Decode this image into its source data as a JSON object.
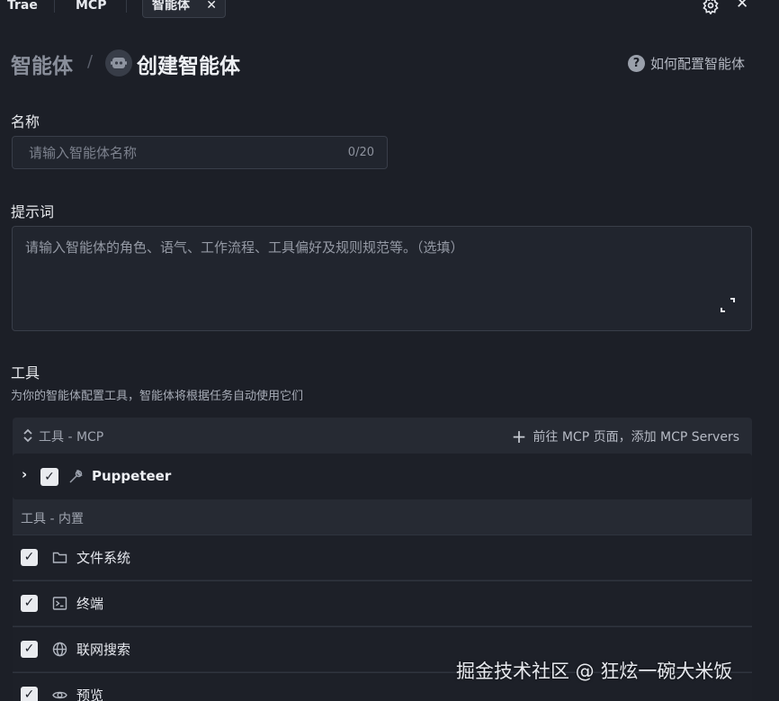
{
  "tabs": [
    {
      "label": "Trae"
    },
    {
      "label": "MCP"
    },
    {
      "label": "智能体",
      "active": true
    }
  ],
  "header": {
    "breadcrumb_root": "智能体",
    "breadcrumb_sep": "/",
    "title": "创建智能体",
    "help_link": "如何配置智能体"
  },
  "form": {
    "name": {
      "label": "名称",
      "placeholder": "请输入智能体名称",
      "value": "",
      "counter": "0/20"
    },
    "prompt": {
      "label": "提示词",
      "placeholder": "请输入智能体的角色、语气、工作流程、工具偏好及规则规范等。（选填）",
      "value": ""
    }
  },
  "tools": {
    "label": "工具",
    "description": "为你的智能体配置工具，智能体将根据任务自动使用它们",
    "mcp_section": "工具 - MCP",
    "add_mcp": "前往 MCP 页面，添加 MCP Servers",
    "mcp_items": [
      {
        "name": "Puppeteer",
        "checked": true,
        "icon": "wrench-icon"
      }
    ],
    "builtin_section": "工具 - 内置",
    "builtin_items": [
      {
        "name": "文件系统",
        "checked": true,
        "icon": "folder-icon"
      },
      {
        "name": "终端",
        "checked": true,
        "icon": "terminal-icon"
      },
      {
        "name": "联网搜索",
        "checked": true,
        "icon": "globe-icon"
      },
      {
        "name": "预览",
        "checked": true,
        "icon": "eye-icon"
      }
    ]
  },
  "watermark": "掘金技术社区 @ 狂炫一碗大米饭",
  "colors": {
    "background": "#1c1f27",
    "panel": "#262a33",
    "row": "#1d2028",
    "checkbox": "#e9ebef"
  }
}
